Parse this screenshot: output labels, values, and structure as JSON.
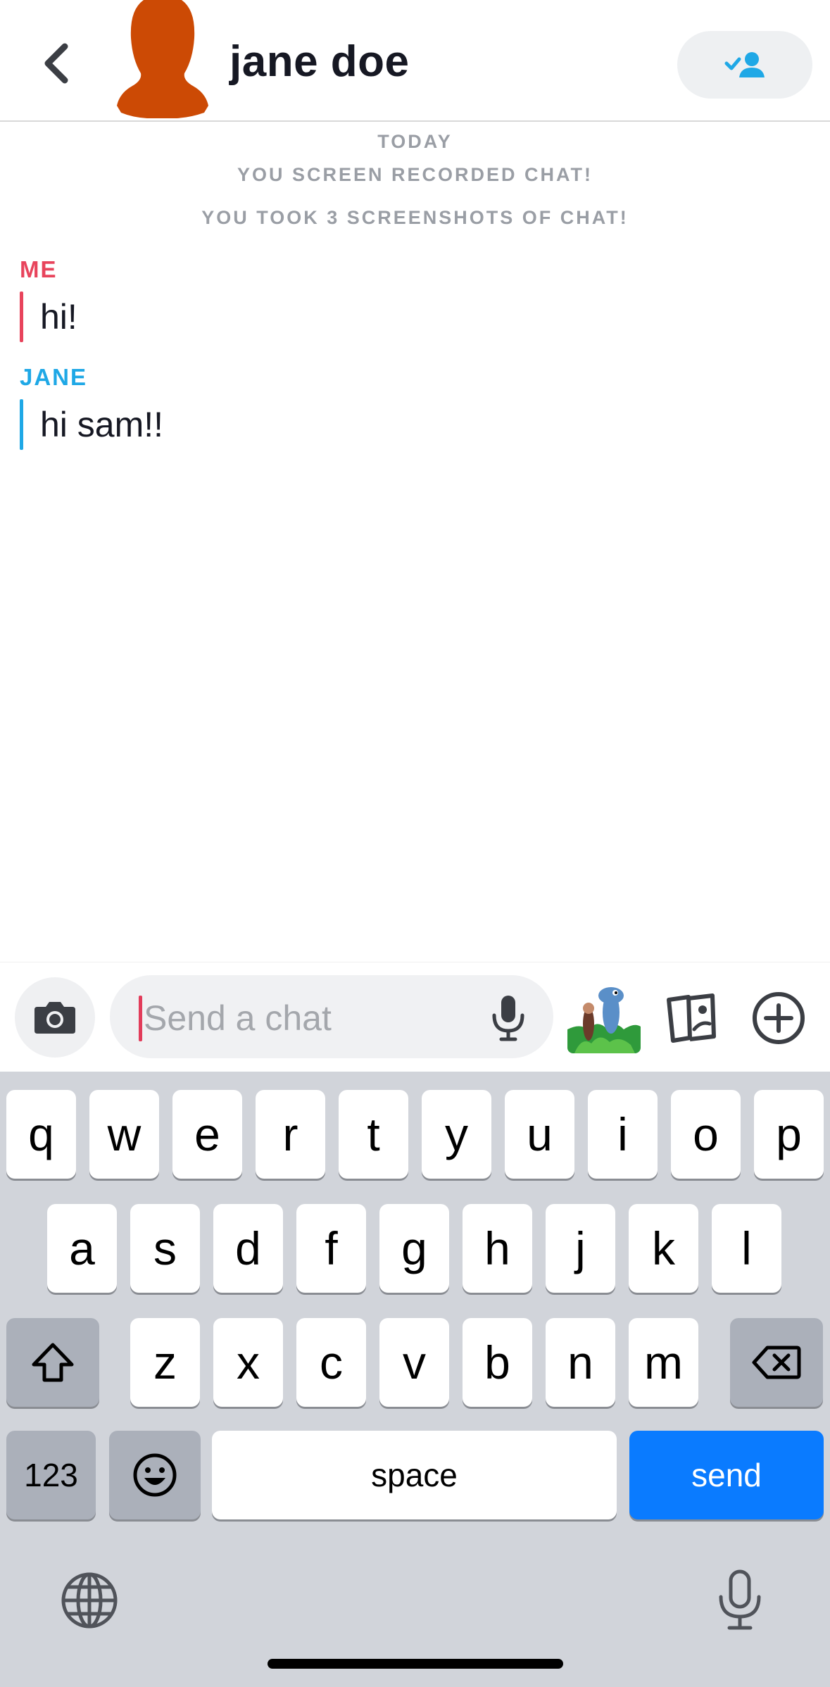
{
  "header": {
    "contact_name": "jane doe"
  },
  "system_messages": {
    "date": "TODAY",
    "screen_recorded": "YOU SCREEN RECORDED CHAT!",
    "screenshots": "YOU TOOK 3 SCREENSHOTS OF CHAT!"
  },
  "messages": [
    {
      "sender": "ME",
      "text": "hi!",
      "color": "#e8445c"
    },
    {
      "sender": "JANE",
      "text": "hi sam!!",
      "color": "#1fa8e6"
    }
  ],
  "composer": {
    "placeholder": "Send a chat",
    "value": ""
  },
  "keyboard": {
    "row1": [
      "q",
      "w",
      "e",
      "r",
      "t",
      "y",
      "u",
      "i",
      "o",
      "p"
    ],
    "row2": [
      "a",
      "s",
      "d",
      "f",
      "g",
      "h",
      "j",
      "k",
      "l"
    ],
    "row3": [
      "z",
      "x",
      "c",
      "v",
      "b",
      "n",
      "m"
    ],
    "numbers_label": "123",
    "space_label": "space",
    "send_label": "send"
  },
  "colors": {
    "accent_blue": "#0a7bff",
    "avatar": "#cc4a05",
    "me": "#e8445c",
    "jane": "#1fa8e6"
  },
  "icons": [
    "back-chevron-icon",
    "avatar-silhouette-icon",
    "add-friend-icon",
    "camera-icon",
    "microphone-icon",
    "sticker-icon",
    "memories-icon",
    "plus-icon",
    "shift-icon",
    "backspace-icon",
    "emoji-icon",
    "globe-icon",
    "dictation-icon"
  ]
}
